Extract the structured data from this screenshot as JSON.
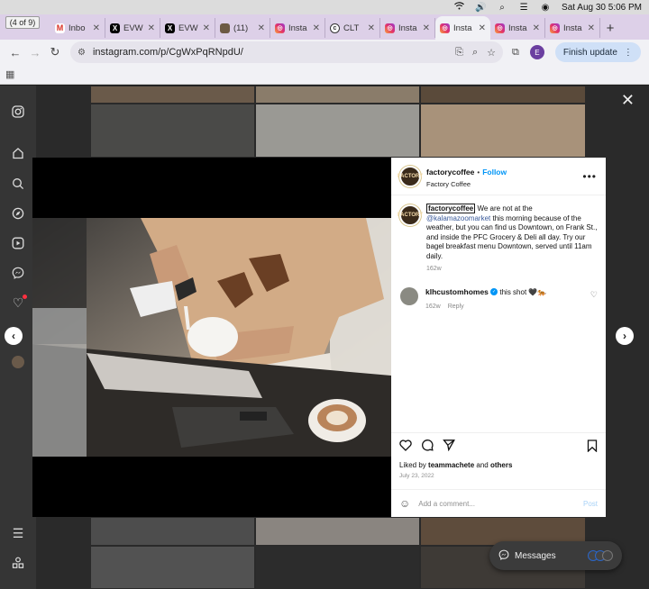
{
  "menubar": {
    "datetime": "Sat Aug 30  5:06 PM",
    "icons": [
      "wifi-icon",
      "volume-icon",
      "search-icon",
      "control-center-icon",
      "user-icon"
    ]
  },
  "tabstrip": {
    "count_label": "(4 of 9)",
    "tabs": [
      {
        "title": "Inbo",
        "icon": "gmail-icon"
      },
      {
        "title": "EVW",
        "icon": "x-icon"
      },
      {
        "title": "EVW",
        "icon": "x-icon"
      },
      {
        "title": "(11)",
        "icon": "site-icon"
      },
      {
        "title": "Insta",
        "icon": "instagram-icon"
      },
      {
        "title": "CLT",
        "icon": "clt-icon"
      },
      {
        "title": "Insta",
        "icon": "instagram-icon"
      },
      {
        "title": "Insta",
        "icon": "instagram-icon",
        "active": true
      },
      {
        "title": "Insta",
        "icon": "instagram-icon"
      },
      {
        "title": "Insta",
        "icon": "instagram-icon"
      }
    ],
    "new_tab": "+"
  },
  "toolbar": {
    "url": "instagram.com/p/CgWxPqRNpdU/",
    "profile_initial": "E",
    "finish_update": "Finish update"
  },
  "sidebar": {
    "icons": [
      "instagram-logo-icon",
      "home-icon",
      "search-icon",
      "explore-icon",
      "reels-icon",
      "messenger-icon",
      "notifications-icon",
      "profile-avatar",
      "menu-icon",
      "more-icon"
    ]
  },
  "post": {
    "username": "factorycoffee",
    "separator": "•",
    "follow": "Follow",
    "location": "Factory Coffee",
    "avatar_text": "FACTORY",
    "caption_username": "factorycoffee",
    "caption_text_1": " We are not at the ",
    "caption_mention": "@kalamazoomarket",
    "caption_text_2": " this morning because of the weather, but you can find us Downtown, on Frank St., and inside the PFC Grocery & Deli all day. Try our bagel breakfast menu Downtown, served until 11am daily.",
    "caption_age": "162w",
    "comment": {
      "username": "klhcustomhomes",
      "text": "this shot 🖤🐅",
      "age": "162w",
      "reply": "Reply"
    },
    "liked_by_prefix": "Liked by ",
    "liked_by_user": "teammachete",
    "liked_by_and": " and ",
    "liked_by_others": "others",
    "date": "July 23, 2022",
    "add_comment_placeholder": "Add a comment...",
    "post_button": "Post"
  },
  "messages": {
    "label": "Messages"
  },
  "colors": {
    "accent": "#0095f6",
    "chrome_tabstrip": "#ddd0e8",
    "finish_update_bg": "#cfe0f7"
  }
}
